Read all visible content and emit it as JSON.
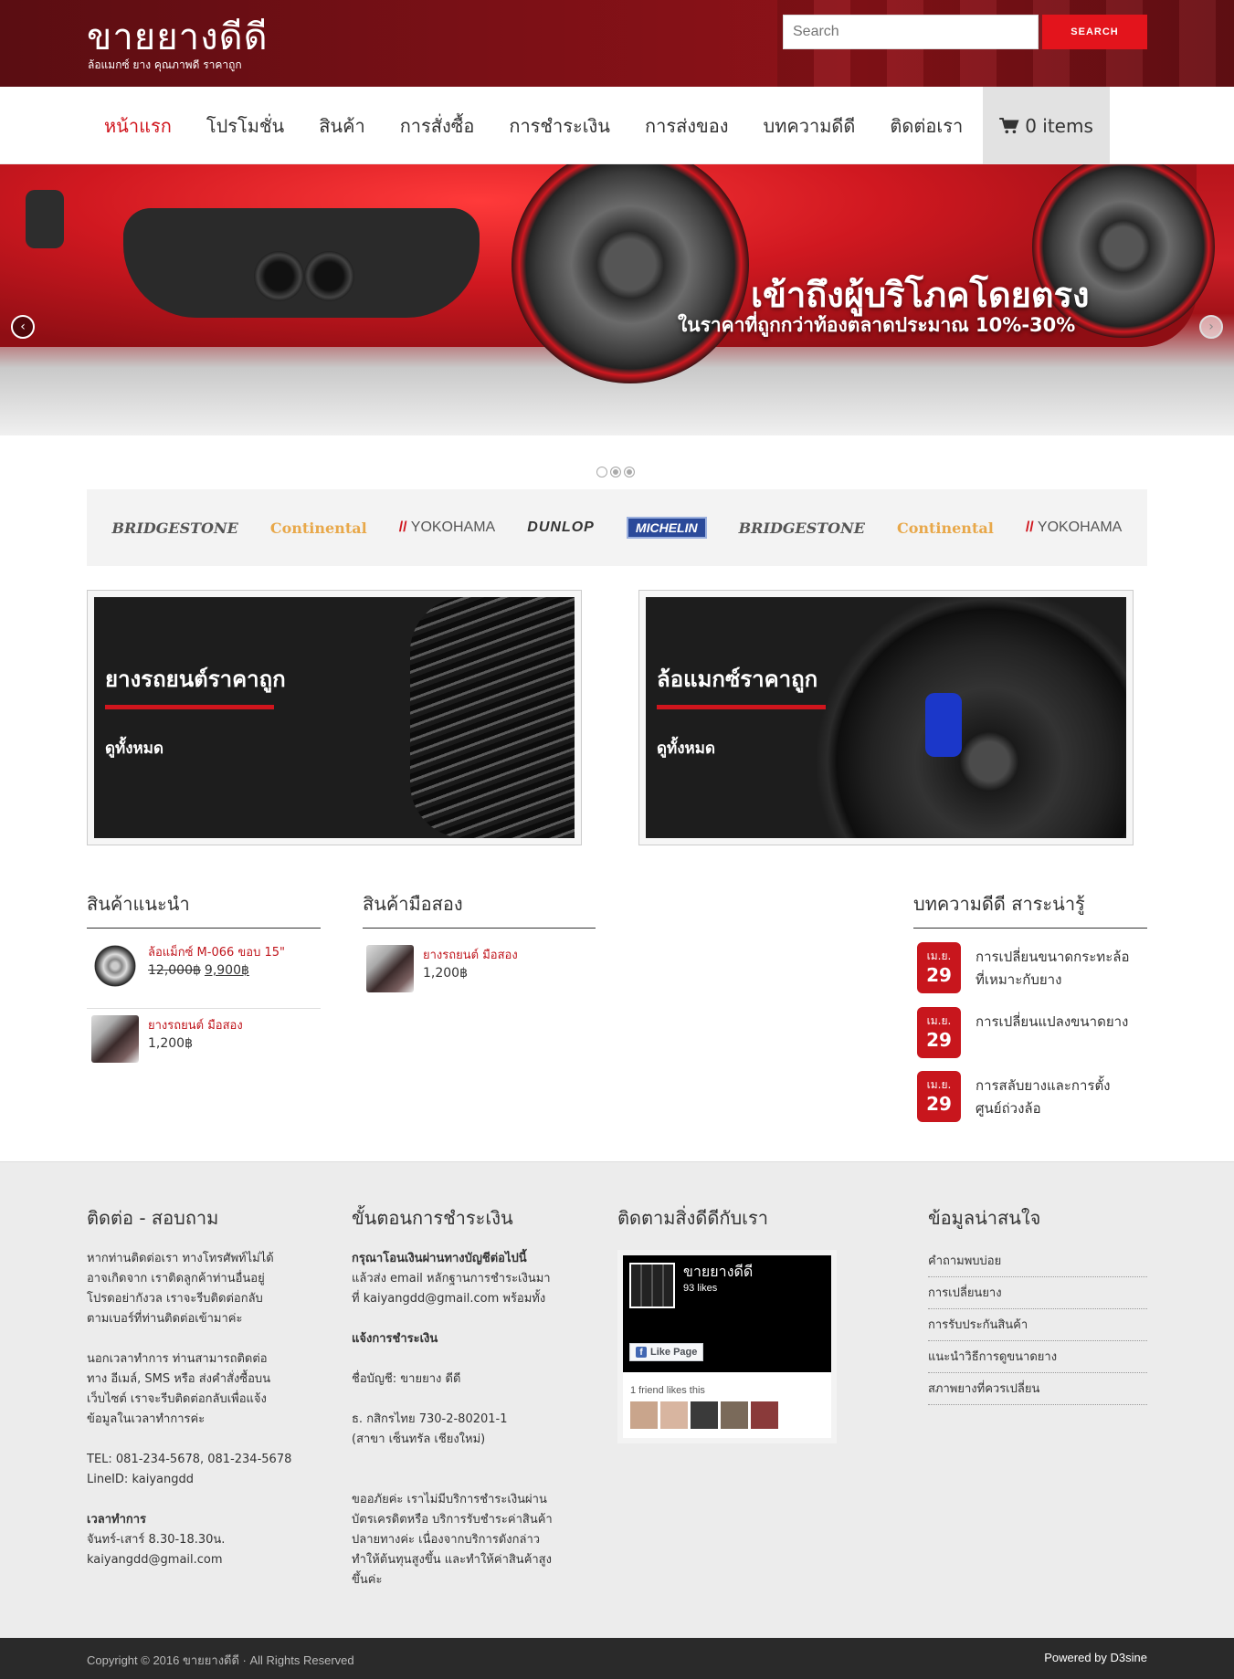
{
  "header": {
    "site_title": "ขายยางดีดี",
    "tagline": "ล้อแมกซ์ ยาง คุณภาพดี ราคาถูก",
    "search_placeholder": "Search",
    "search_button": "SEARCH"
  },
  "nav": {
    "items": [
      "หน้าแรก",
      "โปรโมชั่น",
      "สินค้า",
      "การสั่งซื้อ",
      "การชำระเงิน",
      "การส่งของ",
      "บทความดีดี",
      "ติดต่อเรา"
    ],
    "cart_label": "0 items",
    "active_color": "#d0151d"
  },
  "slider": {
    "title": "เข้าถึงผู้บริโภคโดยตรง",
    "subtitle": "ในราคาที่ถูกกว่าท้องตลาดประมาณ 10%-30%",
    "prev_icon": "chevron-left-icon",
    "next_icon": "chevron-right-icon",
    "slide_count": 3
  },
  "brands": [
    "BRIDGESTONE",
    "Continental",
    "YOKOHAMA",
    "DUNLOP",
    "MICHELIN",
    "BRIDGESTONE",
    "Continental",
    "YOKOHAMA"
  ],
  "promos": [
    {
      "title": "ยางรถยนต์ราคาถูก",
      "link": "ดูทั้งหมด"
    },
    {
      "title": "ล้อแมกซ์ราคาถูก",
      "link": "ดูทั้งหมด"
    }
  ],
  "featured": {
    "title": "สินค้าแนะนำ",
    "items": [
      {
        "name": "ล้อแม็กซ์ M-066 ขอบ 15\"",
        "old_price": "12,000฿",
        "price": "9,900฿"
      },
      {
        "name": "ยางรถยนต์ มือสอง",
        "price": "1,200฿"
      }
    ]
  },
  "secondhand": {
    "title": "สินค้ามือสอง",
    "items": [
      {
        "name": "ยางรถยนต์ มือสอง",
        "price": "1,200฿"
      }
    ]
  },
  "articles": {
    "title": "บทความดีดี สาระน่ารู้",
    "items": [
      {
        "month": "เม.ย.",
        "day": "29",
        "title_line1": "การเปลี่ยนขนาดกระทะล้อ",
        "title_line2": "ที่เหมาะกับยาง"
      },
      {
        "month": "เม.ย.",
        "day": "29",
        "title_line1": "การเปลี่ยนแปลงขนาดยาง",
        "title_line2": ""
      },
      {
        "month": "เม.ย.",
        "day": "29",
        "title_line1": "การสลับยางและการตั้ง",
        "title_line2": "ศูนย์ถ่วงล้อ"
      }
    ]
  },
  "footer": {
    "contact": {
      "title": "ติดต่อ - สอบถาม",
      "p1": [
        "หากท่านติดต่อเรา ทางโทรศัพท์ไม่ได้",
        "อาจเกิดจาก เราติดลูกค้าท่านอื่นอยู่",
        "โปรดอย่ากังวล เราจะรีบติดต่อกลับ",
        "ตามเบอร์ที่ท่านติดต่อเข้ามาค่ะ"
      ],
      "p2": [
        "นอกเวลาทำการ ท่านสามารถติดต่อ",
        "ทาง อีเมล์, SMS หรือ ส่งคำสั่งซื้อบน",
        "เว็บไซต์ เราจะรีบติดต่อกลับเพื่อแจ้ง",
        "ข้อมูลในเวลาทำการค่ะ"
      ],
      "tel": "TEL: 081-234-5678, 081-234-5678",
      "line": "LineID: kaiyangdd",
      "hours_title": "เวลาทำการ",
      "hours": "จันทร์-เสาร์ 8.30-18.30น.",
      "email": "kaiyangdd@gmail.com"
    },
    "payment": {
      "title": "ขั้นตอนการชำระเงิน",
      "p1_bold": "กรุณาโอนเงินผ่านทางบัญชีต่อไปนี้",
      "p1": [
        "แล้วส่ง email หลักฐานการชำระเงินมา",
        "ที่ kaiyangdd@gmail.com พร้อมทั้ง"
      ],
      "notify": "แจ้งการชำระเงิน",
      "account_name": "ชื่อบัญชี: ขายยาง ดีดี",
      "bank": "ธ. กสิกรไทย 730-2-80201-1",
      "branch": "(สาขา เซ็นทรัล เชียงใหม่)",
      "p3": [
        "ขออภัยค่ะ เราไม่มีบริการชำระเงินผ่าน",
        "บัตรเครดิตหรือ บริการรับชำระค่าสินค้า",
        "ปลายทางค่ะ เนื่องจากบริการดังกล่าว",
        "ทำให้ต้นทุนสูงขึ้น และทำให้ค่าสินค้าสูง",
        "ขึ้นค่ะ"
      ]
    },
    "follow": {
      "title": "ติดตามสิ่งดีดีกับเรา",
      "page_name": "ขายยางดีดี",
      "likes": "93 likes",
      "like_button": "Like Page",
      "friends": "1 friend likes this"
    },
    "info": {
      "title": "ข้อมูลน่าสนใจ",
      "links": [
        "คำถามพบบ่อย",
        "การเปลี่ยนยาง",
        "การรับประกันสินค้า",
        "แนะนำวิธีการดูขนาดยาง",
        "สภาพยางที่ควรเปลี่ยน"
      ]
    }
  },
  "bottom": {
    "copyright": "Copyright © 2016 ขายยางดีดี · All Rights Reserved",
    "powered": "Powered by D3sine"
  }
}
